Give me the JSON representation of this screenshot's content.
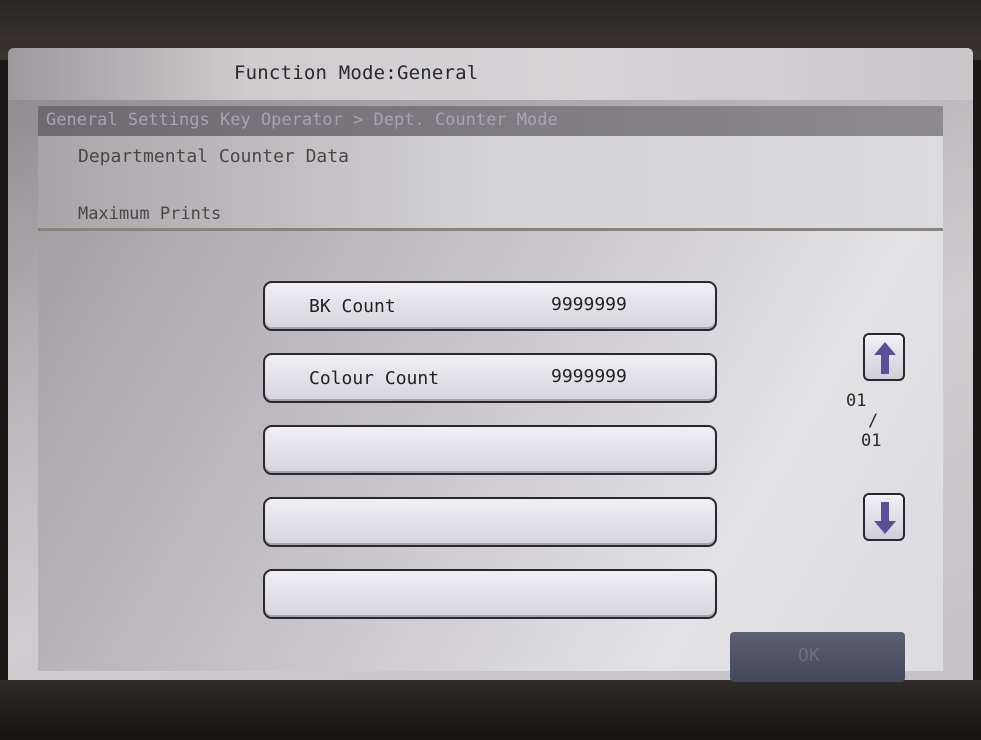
{
  "header": {
    "function_mode": "Function Mode:General"
  },
  "breadcrumb": {
    "path": "General Settings Key Operator > Dept. Counter Mode"
  },
  "panel": {
    "title": "Departmental Counter Data",
    "subtitle": "Maximum Prints"
  },
  "counters": [
    {
      "label": "BK Count",
      "value": "9999999"
    },
    {
      "label": "Colour Count",
      "value": "9999999"
    },
    {
      "label": "",
      "value": ""
    },
    {
      "label": "",
      "value": ""
    },
    {
      "label": "",
      "value": ""
    }
  ],
  "pagination": {
    "current": "01",
    "separator": "/",
    "total": "01",
    "up_icon": "arrow-up-icon",
    "down_icon": "arrow-down-icon"
  },
  "footer": {
    "ok_label": "OK"
  },
  "colors": {
    "accent": "#5b4f9a",
    "button_border": "#2a282e",
    "screen_bg": "#cfcdd0"
  }
}
